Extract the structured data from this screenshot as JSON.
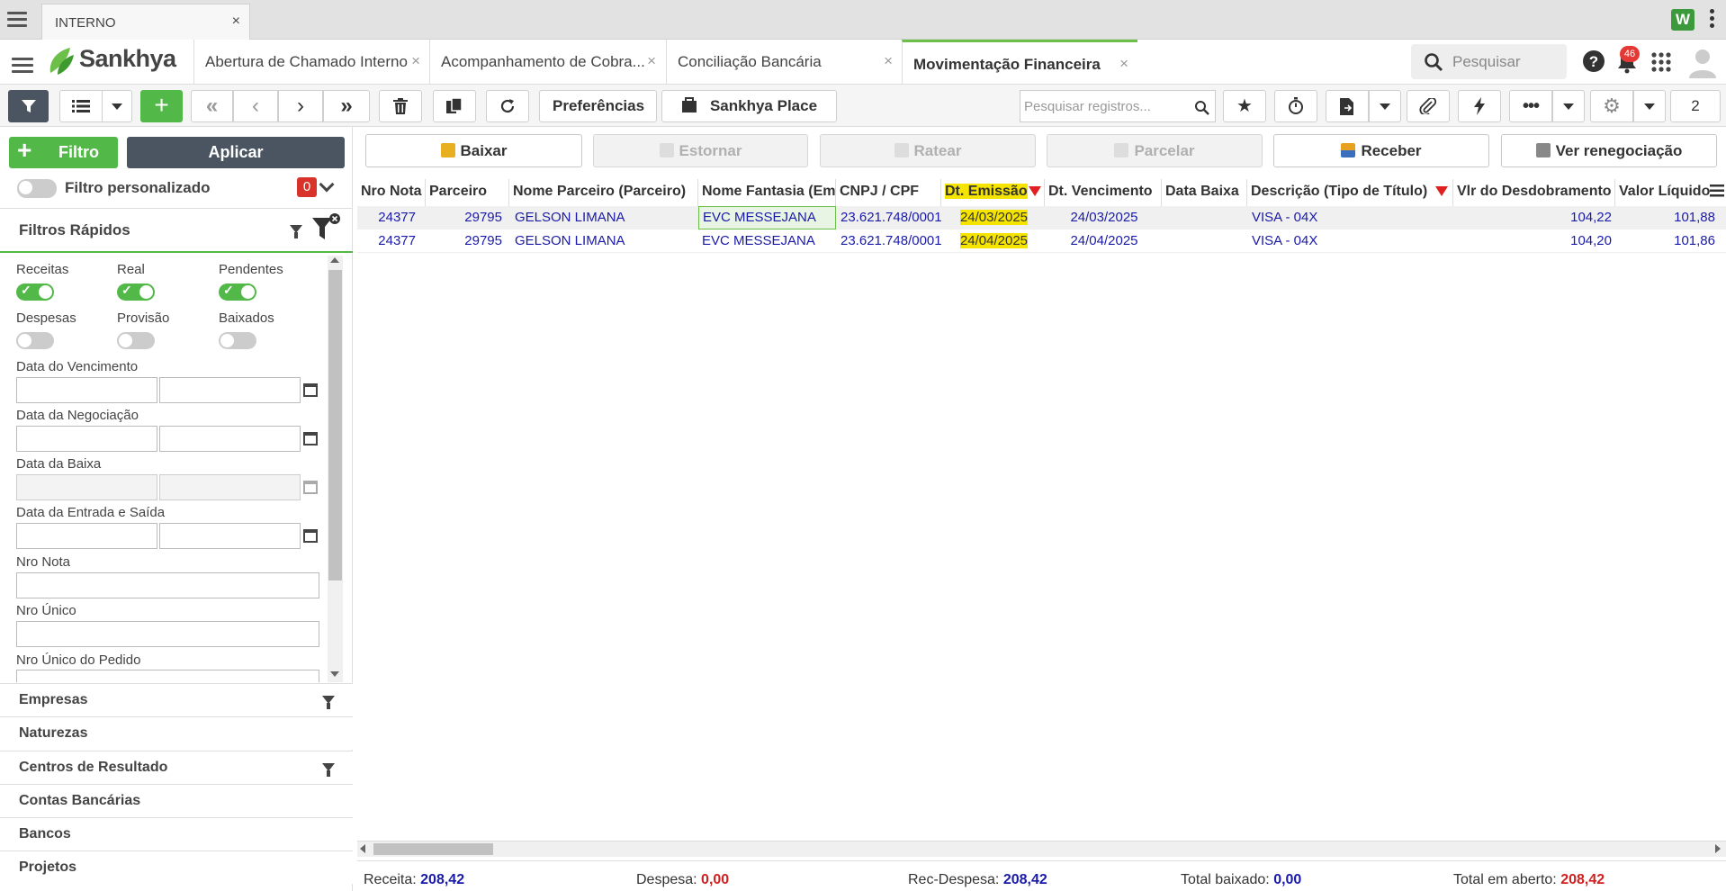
{
  "browser": {
    "tab_title": "INTERNO",
    "tab_close": "×"
  },
  "header": {
    "logo": "Sankhya",
    "tabs": [
      {
        "label": "Abertura de Chamado Interno",
        "close": "×"
      },
      {
        "label": "Acompanhamento de Cobra...",
        "close": "×"
      },
      {
        "label": "Conciliação Bancária",
        "close": "×"
      },
      {
        "label": "Movimentação Financeira",
        "close": "×"
      }
    ],
    "search_placeholder": "Pesquisar",
    "notifications_count": "46"
  },
  "toolbar": {
    "preferencias": "Preferências",
    "sankhya_place": "Sankhya Place",
    "search_placeholder": "Pesquisar registros...",
    "page_input": "2"
  },
  "left": {
    "filtro_label": "Filtro",
    "aplicar_label": "Aplicar",
    "filtro_personalizado": "Filtro personalizado",
    "filtro_count": "0",
    "filtros_rapidos": "Filtros Rápidos",
    "toggles": [
      {
        "label": "Receitas",
        "on": true
      },
      {
        "label": "Real",
        "on": true
      },
      {
        "label": "Pendentes",
        "on": true
      },
      {
        "label": "Despesas",
        "on": false
      },
      {
        "label": "Provisão",
        "on": false
      },
      {
        "label": "Baixados",
        "on": false
      }
    ],
    "fields": {
      "data_vencimento": "Data do Vencimento",
      "data_negociacao": "Data da Negociação",
      "data_baixa": "Data da Baixa",
      "data_entrada_saida": "Data da Entrada e Saída",
      "nro_nota": "Nro Nota",
      "nro_unico": "Nro Único",
      "nro_unico_pedido": "Nro Único do Pedido"
    },
    "sections": [
      "Empresas",
      "Naturezas",
      "Centros de Resultado",
      "Contas Bancárias",
      "Bancos",
      "Projetos"
    ]
  },
  "actions": {
    "baixar": "Baixar",
    "estornar": "Estornar",
    "ratear": "Ratear",
    "parcelar": "Parcelar",
    "receber": "Receber",
    "ver_renegociacao": "Ver renegociação"
  },
  "grid": {
    "columns": [
      "Nro Nota",
      "Parceiro",
      "Nome Parceiro (Parceiro)",
      "Nome Fantasia (Empresa)",
      "CNPJ / CPF",
      "Dt. Emissão",
      "Dt. Vencimento",
      "Data Baixa",
      "Descrição (Tipo de Título)",
      "Vlr do Desdobramento",
      "Valor Líquido"
    ],
    "rows": [
      {
        "nro_nota": "24377",
        "parceiro": "29795",
        "nome_parceiro": "GELSON LIMANA",
        "nome_fantasia": "EVC MESSEJANA",
        "cnpj": "23.621.748/0001",
        "dt_emissao": "24/03/2025",
        "dt_vencimento": "24/03/2025",
        "data_baixa": "",
        "descricao": "VISA - 04X",
        "vlr_desdobramento": "104,22",
        "valor_liquido": "101,88"
      },
      {
        "nro_nota": "24377",
        "parceiro": "29795",
        "nome_parceiro": "GELSON LIMANA",
        "nome_fantasia": "EVC MESSEJANA",
        "cnpj": "23.621.748/0001",
        "dt_emissao": "24/04/2025",
        "dt_vencimento": "24/04/2025",
        "data_baixa": "",
        "descricao": "VISA - 04X",
        "vlr_desdobramento": "104,20",
        "valor_liquido": "101,86"
      }
    ]
  },
  "footer": {
    "receita_label": "Receita:",
    "receita_value": "208,42",
    "despesa_label": "Despesa:",
    "despesa_value": "0,00",
    "rec_despesa_label": "Rec-Despesa:",
    "rec_despesa_value": "208,42",
    "total_baixado_label": "Total baixado:",
    "total_baixado_value": "0,00",
    "total_aberto_label": "Total em aberto:",
    "total_aberto_value": "208,42"
  },
  "colors": {
    "accent_green": "#52b848",
    "dark_button": "#4a5561",
    "link_blue": "#1a1aa8",
    "highlight_yellow": "#f5e300",
    "negative_red": "#d02020"
  }
}
